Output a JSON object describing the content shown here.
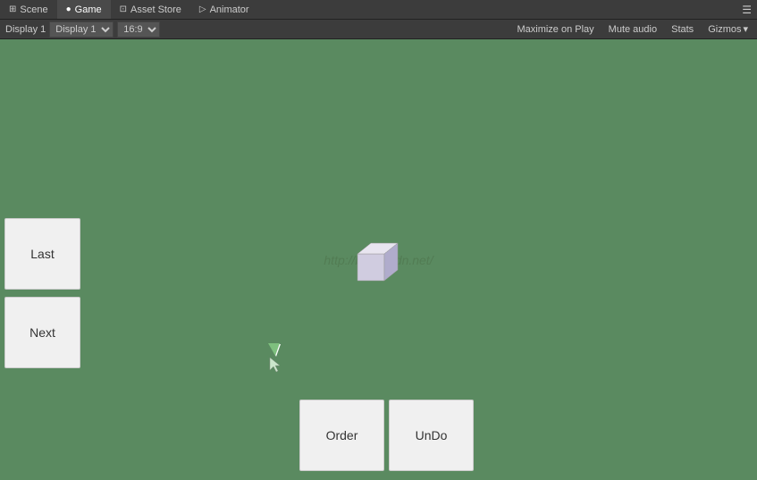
{
  "tabs": [
    {
      "id": "scene",
      "label": "Scene",
      "icon": "⊞",
      "active": false
    },
    {
      "id": "game",
      "label": "Game",
      "icon": "●",
      "active": true
    },
    {
      "id": "asset-store",
      "label": "Asset Store",
      "icon": "⊡",
      "active": false
    },
    {
      "id": "animator",
      "label": "Animator",
      "icon": "▷",
      "active": false
    }
  ],
  "toolbar": {
    "display_label": "Display 1",
    "aspect_ratio": "16:9",
    "maximize_on_play": "Maximize on Play",
    "mute_audio": "Mute audio",
    "stats": "Stats",
    "gizmos": "Gizmos",
    "gizmos_arrow": "▾"
  },
  "viewport": {
    "watermark": "http://blog.csdn.net/",
    "background_color": "#5a8a60"
  },
  "buttons": {
    "last": "Last",
    "next": "Next",
    "order": "Order",
    "undo": "UnDo"
  },
  "cursor": {
    "visible": true
  }
}
